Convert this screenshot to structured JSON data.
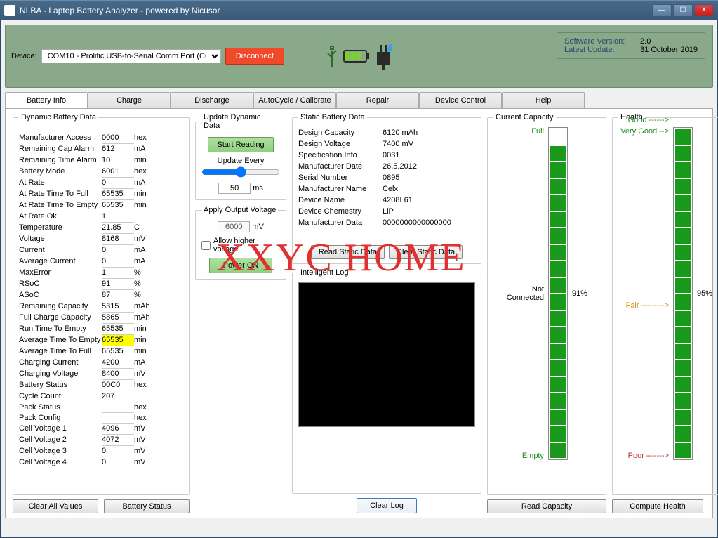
{
  "window": {
    "title": "NLBA - Laptop Battery Analyzer - powered by Nicusor"
  },
  "header": {
    "device_label": "Device:",
    "device_selected": "COM10 - Prolific USB-to-Serial Comm Port (COM10)",
    "disconnect": "Disconnect",
    "version_label": "Software Version:",
    "version_value": "2.0",
    "update_label": "Latest Update:",
    "update_value": "31 October 2019"
  },
  "tabs": [
    "Battery Info",
    "Charge",
    "Discharge",
    "AutoCycle / Calibrate",
    "Repair",
    "Device Control",
    "Help"
  ],
  "dynamic": {
    "legend": "Dynamic Battery Data",
    "rows": [
      {
        "l": "Manufacturer Access",
        "v": "0000",
        "u": "hex"
      },
      {
        "l": "Remaining Cap Alarm",
        "v": "612",
        "u": "mA"
      },
      {
        "l": "Remaining Time Alarm",
        "v": "10",
        "u": "min"
      },
      {
        "l": "Battery Mode",
        "v": "6001",
        "u": "hex"
      },
      {
        "l": "At Rate",
        "v": "0",
        "u": "mA"
      },
      {
        "l": "At Rate Time To Full",
        "v": "65535",
        "u": "min"
      },
      {
        "l": "At Rate Time To Empty",
        "v": "65535",
        "u": "min"
      },
      {
        "l": "At Rate Ok",
        "v": "1",
        "u": ""
      },
      {
        "l": "Temperature",
        "v": "21.85",
        "u": "C"
      },
      {
        "l": "Voltage",
        "v": "8168",
        "u": "mV"
      },
      {
        "l": "Current",
        "v": "0",
        "u": "mA"
      },
      {
        "l": "Average Current",
        "v": "0",
        "u": "mA"
      },
      {
        "l": "MaxError",
        "v": "1",
        "u": "%"
      },
      {
        "l": "RSoC",
        "v": "91",
        "u": "%"
      },
      {
        "l": "ASoC",
        "v": "87",
        "u": "%"
      },
      {
        "l": "Remaining Capacity",
        "v": "5315",
        "u": "mAh"
      },
      {
        "l": "Full Charge Capacity",
        "v": "5865",
        "u": "mAh"
      },
      {
        "l": "Run Time To Empty",
        "v": "65535",
        "u": "min"
      },
      {
        "l": "Average Time To Empty",
        "v": "65535",
        "u": "min",
        "hl": true
      },
      {
        "l": "Average Time To Full",
        "v": "65535",
        "u": "min"
      },
      {
        "l": "Charging Current",
        "v": "4200",
        "u": "mA"
      },
      {
        "l": "Charging Voltage",
        "v": "8400",
        "u": "mV"
      },
      {
        "l": "Battery Status",
        "v": "00C0",
        "u": "hex"
      },
      {
        "l": "Cycle Count",
        "v": "207",
        "u": ""
      },
      {
        "l": "Pack Status",
        "v": "",
        "u": "hex"
      },
      {
        "l": "Pack Config",
        "v": "",
        "u": "hex"
      },
      {
        "l": "Cell Voltage 1",
        "v": "4096",
        "u": "mV"
      },
      {
        "l": "Cell Voltage 2",
        "v": "4072",
        "u": "mV"
      },
      {
        "l": "Cell Voltage 3",
        "v": "0",
        "u": "mV"
      },
      {
        "l": "Cell Voltage 4",
        "v": "0",
        "u": "mV"
      }
    ]
  },
  "update": {
    "legend": "Update Dynamic Data",
    "start": "Start Reading",
    "every": "Update Every",
    "interval": "50",
    "ms": "ms"
  },
  "apply": {
    "legend": "Apply Output Voltage",
    "value": "6000",
    "unit": "mV",
    "allow": "Allow higher voltage",
    "power": "Power ON"
  },
  "static": {
    "legend": "Static Battery Data",
    "rows": [
      {
        "l": "Design Capacity",
        "v": "6120 mAh"
      },
      {
        "l": "Design Voltage",
        "v": "7400 mV"
      },
      {
        "l": "Specification Info",
        "v": "0031"
      },
      {
        "l": "Manufacturer Date",
        "v": "26.5.2012"
      },
      {
        "l": "Serial Number",
        "v": "0895"
      },
      {
        "l": "Manufacturer Name",
        "v": "Celx"
      },
      {
        "l": "Device Name",
        "v": "4208L61"
      },
      {
        "l": "Device Chemestry",
        "v": "LiP"
      },
      {
        "l": "Manufacturer Data",
        "v": "0000000000000000"
      }
    ],
    "read": "Read Static Data",
    "clear": "Clear Static Data"
  },
  "log": {
    "legend": "Intelligent Log"
  },
  "capacity": {
    "legend": "Current Capacity",
    "full": "Full",
    "notconnected": "Not Connected",
    "empty": "Empty",
    "pct": "91%",
    "segments": 20,
    "on": 19
  },
  "health": {
    "legend": "Health",
    "verygood": "Very Good -->",
    "good": "Good ------>",
    "fair": "Fair --------->",
    "poor": "Poor ------->",
    "pct": "95%",
    "segments": 20,
    "on": 20
  },
  "buttons": {
    "clear_all": "Clear All Values",
    "battery_status": "Battery Status",
    "clear_log": "Clear Log",
    "read_capacity": "Read Capacity",
    "compute_health": "Compute Health"
  },
  "watermark": "XXYC  HOME"
}
